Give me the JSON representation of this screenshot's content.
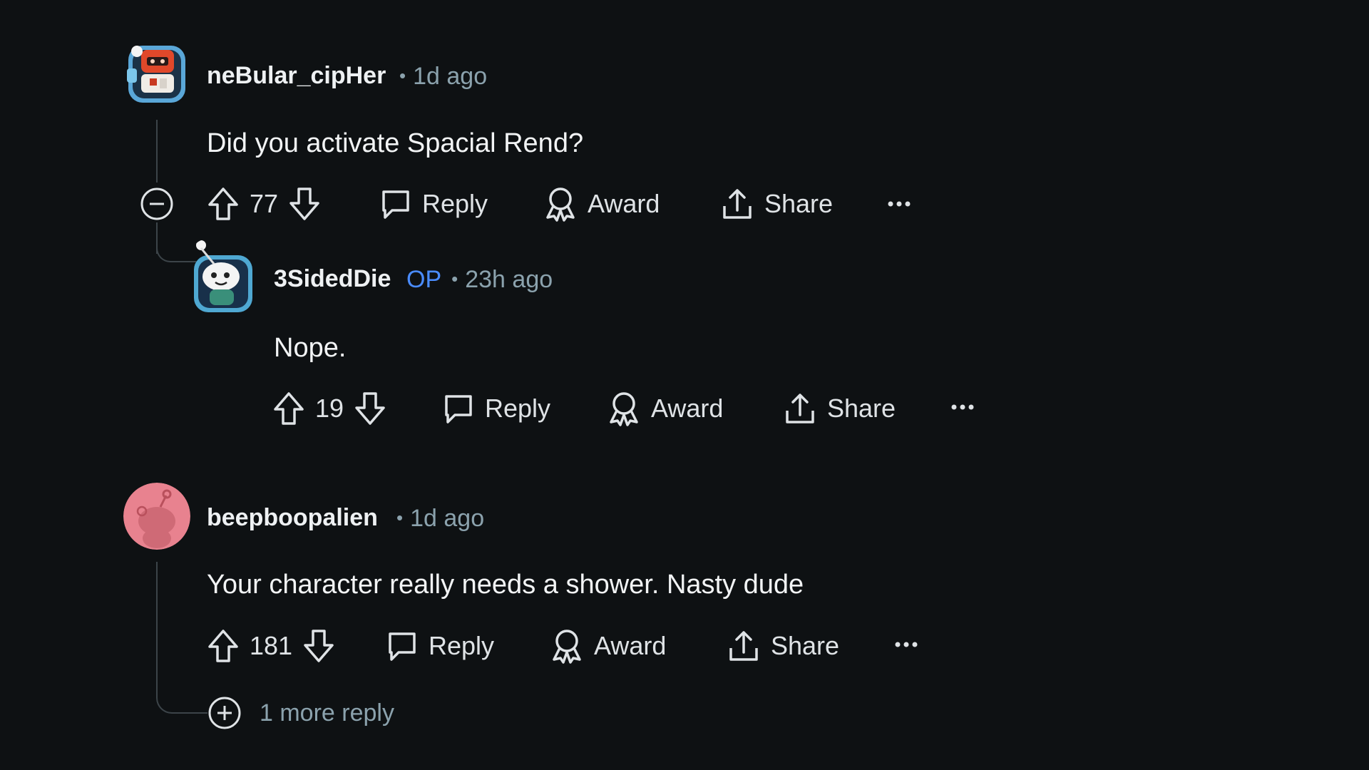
{
  "comments": [
    {
      "username": "neBular_cipHer",
      "time": "1d ago",
      "body": "Did you activate Spacial Rend?",
      "score": "77",
      "actions": {
        "reply": "Reply",
        "award": "Award",
        "share": "Share",
        "more": "···"
      },
      "children": [
        {
          "username": "3SidedDie",
          "badge": "OP",
          "time": "23h ago",
          "body": "Nope.",
          "score": "19",
          "actions": {
            "reply": "Reply",
            "award": "Award",
            "share": "Share",
            "more": "···"
          }
        }
      ]
    },
    {
      "username": "beepboopalien",
      "time": "1d ago",
      "body": "Your character really needs a shower. Nasty dude",
      "score": "181",
      "actions": {
        "reply": "Reply",
        "award": "Award",
        "share": "Share",
        "more": "···"
      },
      "more_replies": "1 more reply"
    }
  ],
  "colors": {
    "background": "#0e1113",
    "text": "#dfe3e6",
    "meta": "#8ba2ad",
    "op_badge": "#4a8cff",
    "thread_line": "#3c4449",
    "alien_avatar_bg": "#e8828f"
  },
  "icons": [
    "upvote-icon",
    "downvote-icon",
    "comment-icon",
    "award-icon",
    "share-icon",
    "collapse-icon",
    "expand-icon",
    "more-icon"
  ]
}
